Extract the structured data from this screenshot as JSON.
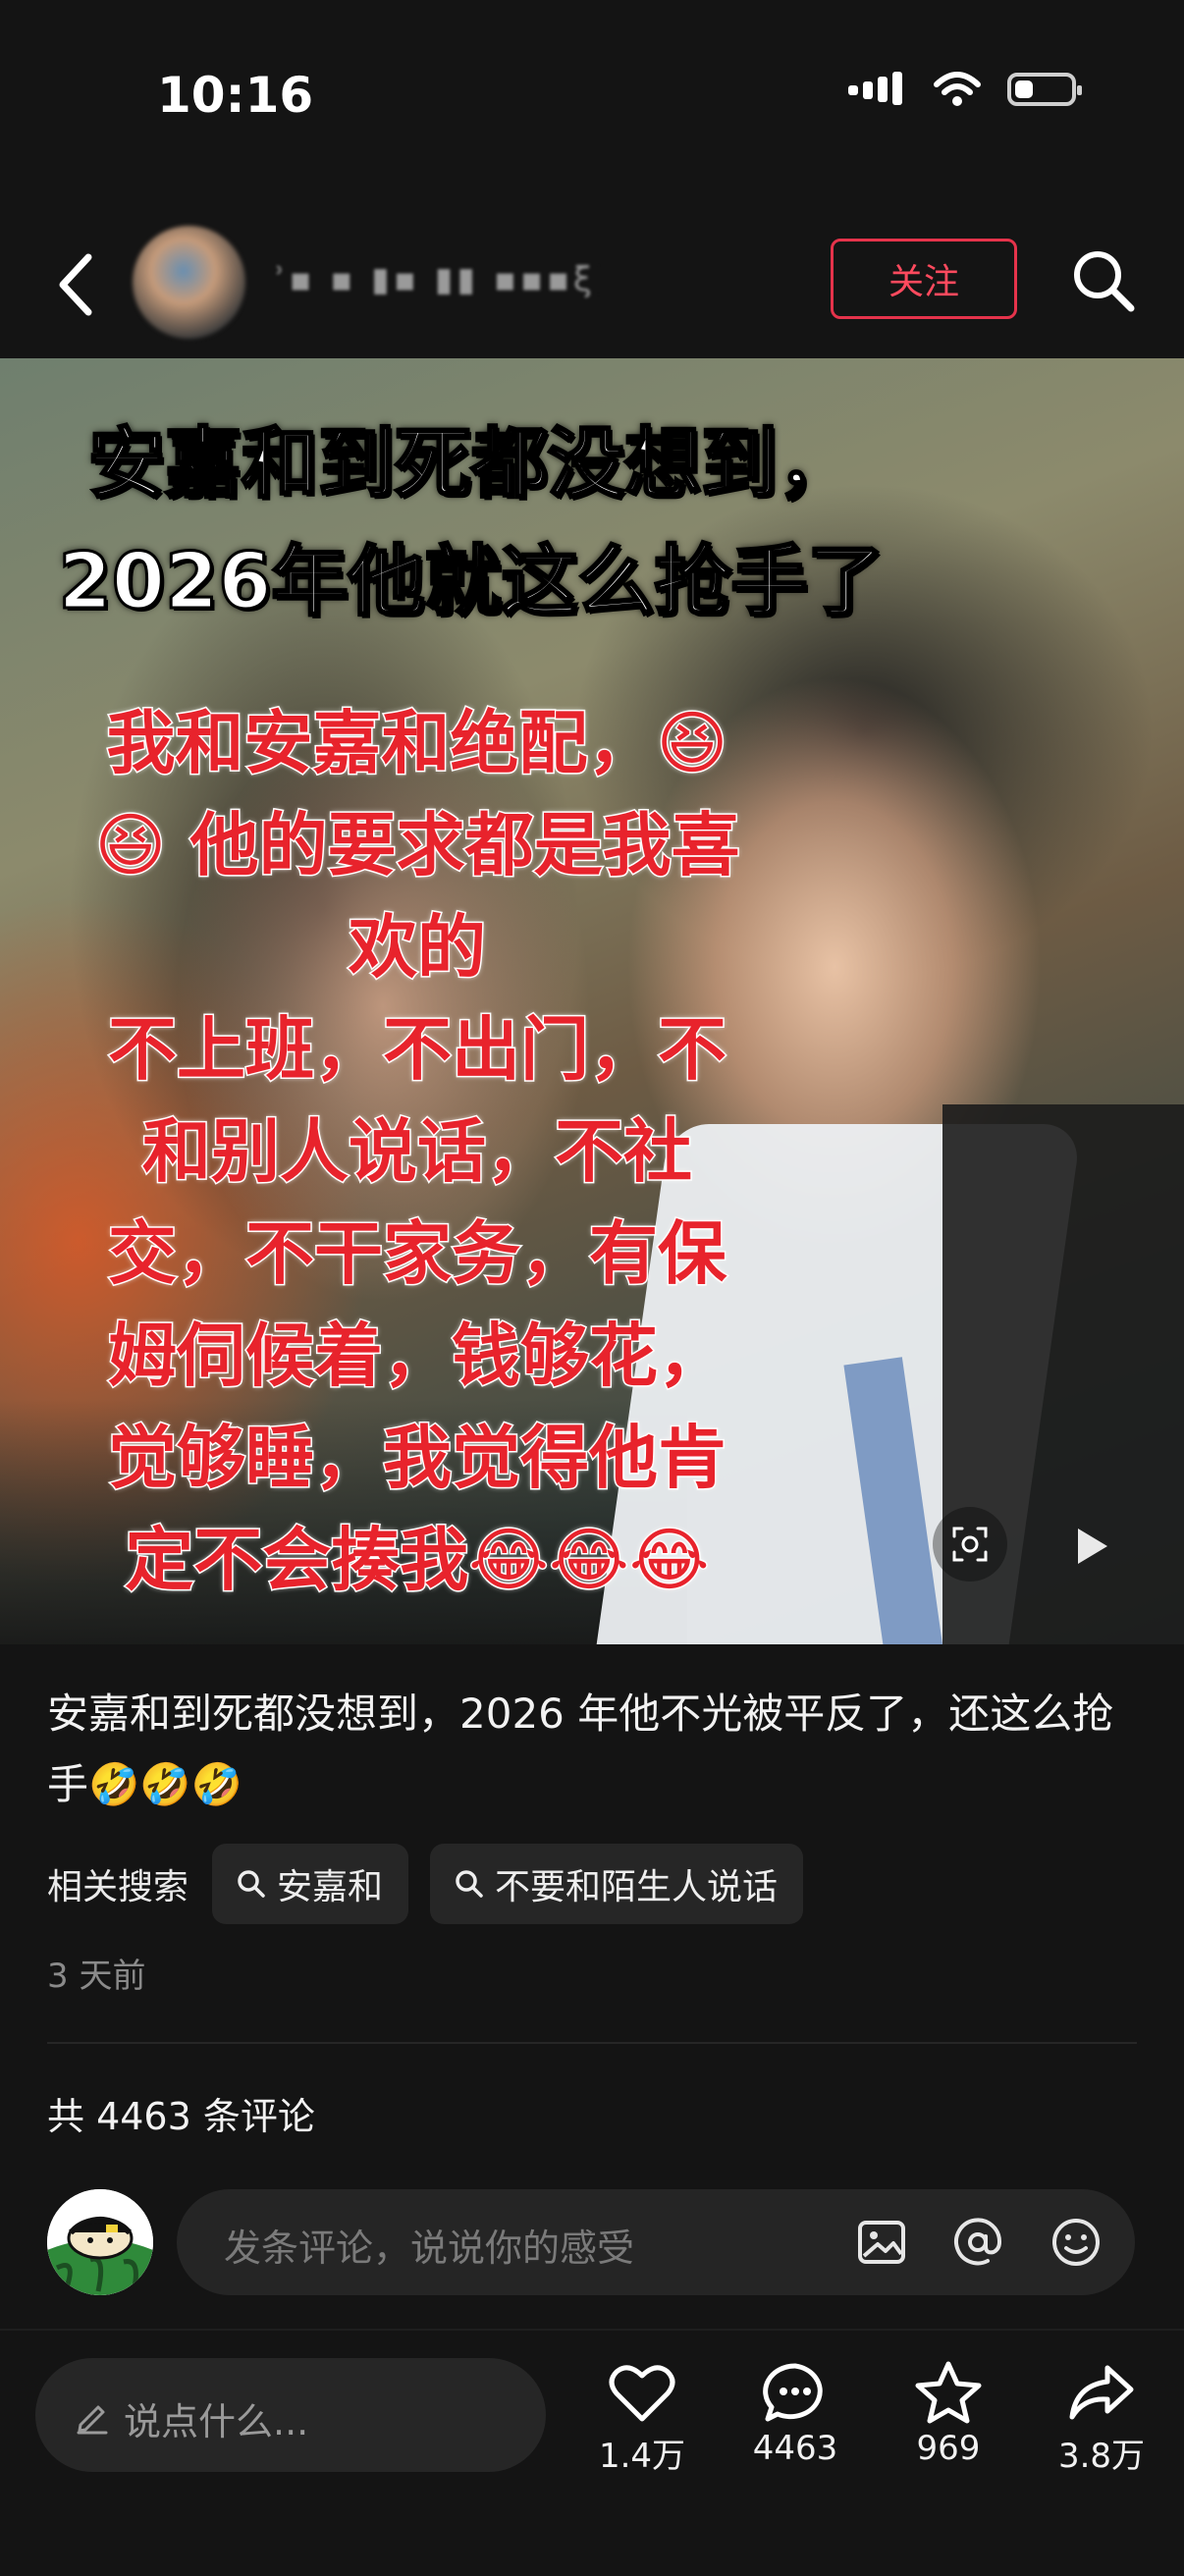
{
  "status_bar": {
    "time": "10:16"
  },
  "header": {
    "follow_label": "关注",
    "username_masked": "ʾ▪ ▪ ▮▪ ▮▮ ▪▪▪ξ)"
  },
  "post": {
    "headline_line1": "安嘉和到死都没想到，",
    "headline_line2": "2026年他就这么抢手了",
    "overlay_text": "我和安嘉和绝配，😆\n😆 他的要求都是我喜\n欢的\n不上班，不出门，不\n和别人说话，不社\n交，不干家务，有保\n姆伺候着，钱够花，\n觉够睡，我觉得他肯\n定不会揍我😂😂😂",
    "caption": "安嘉和到死都没想到，2026 年他不光被平反了，还这么抢手🤣🤣🤣",
    "related_label": "相关搜索",
    "related_searches": [
      "安嘉和",
      "不要和陌生人说话"
    ],
    "time_ago": "3 天前"
  },
  "comments": {
    "count_text": "共 4463 条评论",
    "input_placeholder": "发条评论，说说你的感受"
  },
  "bottom_bar": {
    "say_placeholder": "说点什么...",
    "like_count": "1.4万",
    "comment_count": "4463",
    "favorite_count": "969",
    "share_count": "3.8万"
  },
  "colors": {
    "accent_red": "#e5334b",
    "background": "#141414"
  }
}
